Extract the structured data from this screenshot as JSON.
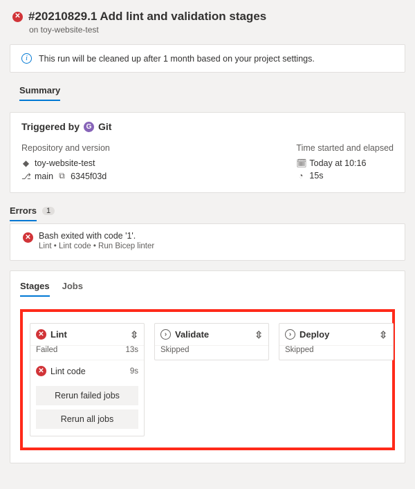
{
  "header": {
    "title": "#20210829.1 Add lint and validation stages",
    "subtitle": "on toy-website-test"
  },
  "info_banner": "This run will be cleaned up after 1 month based on your project settings.",
  "summary_label": "Summary",
  "triggered": {
    "prefix": "Triggered by",
    "avatar_letter": "G",
    "name": "Git"
  },
  "repo": {
    "heading": "Repository and version",
    "name": "toy-website-test",
    "branch": "main",
    "commit": "6345f03d"
  },
  "time": {
    "heading": "Time started and elapsed",
    "started": "Today at 10:16",
    "elapsed": "15s"
  },
  "errors": {
    "heading": "Errors",
    "count": "1",
    "items": [
      {
        "message": "Bash exited with code '1'.",
        "path": "Lint • Lint code • Run Bicep linter"
      }
    ]
  },
  "tabs": {
    "stages": "Stages",
    "jobs": "Jobs"
  },
  "stages": [
    {
      "name": "Lint",
      "status": "Failed",
      "duration": "13s",
      "state": "error",
      "jobs": [
        {
          "name": "Lint code",
          "duration": "9s",
          "state": "error"
        }
      ],
      "buttons": {
        "rerun_failed": "Rerun failed jobs",
        "rerun_all": "Rerun all jobs"
      }
    },
    {
      "name": "Validate",
      "status": "Skipped",
      "state": "skipped"
    },
    {
      "name": "Deploy",
      "status": "Skipped",
      "state": "skipped"
    }
  ]
}
